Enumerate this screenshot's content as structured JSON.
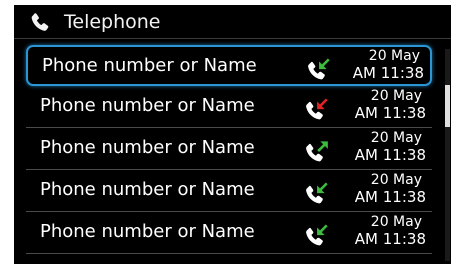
{
  "header": {
    "title": "Telephone",
    "icon": "phone-icon"
  },
  "colors": {
    "selection_border": "#2a97d4",
    "received": "#3dbb3d",
    "missed": "#e02222",
    "dialed": "#3dbb3d"
  },
  "calls": [
    {
      "name": "Phone number or Name",
      "date": "20 May",
      "time": "AM 11:38",
      "type": "received",
      "icon": "received-call-icon",
      "selected": true
    },
    {
      "name": "Phone number or Name",
      "date": "20 May",
      "time": "AM 11:38",
      "type": "missed",
      "icon": "missed-call-icon",
      "selected": false
    },
    {
      "name": "Phone number or Name",
      "date": "20 May",
      "time": "AM 11:38",
      "type": "dialed",
      "icon": "dialed-call-icon",
      "selected": false
    },
    {
      "name": "Phone number or Name",
      "date": "20 May",
      "time": "AM 11:38",
      "type": "received",
      "icon": "received-call-icon",
      "selected": false
    },
    {
      "name": "Phone number or Name",
      "date": "20 May",
      "time": "AM 11:38",
      "type": "received",
      "icon": "received-call-icon",
      "selected": false
    }
  ]
}
